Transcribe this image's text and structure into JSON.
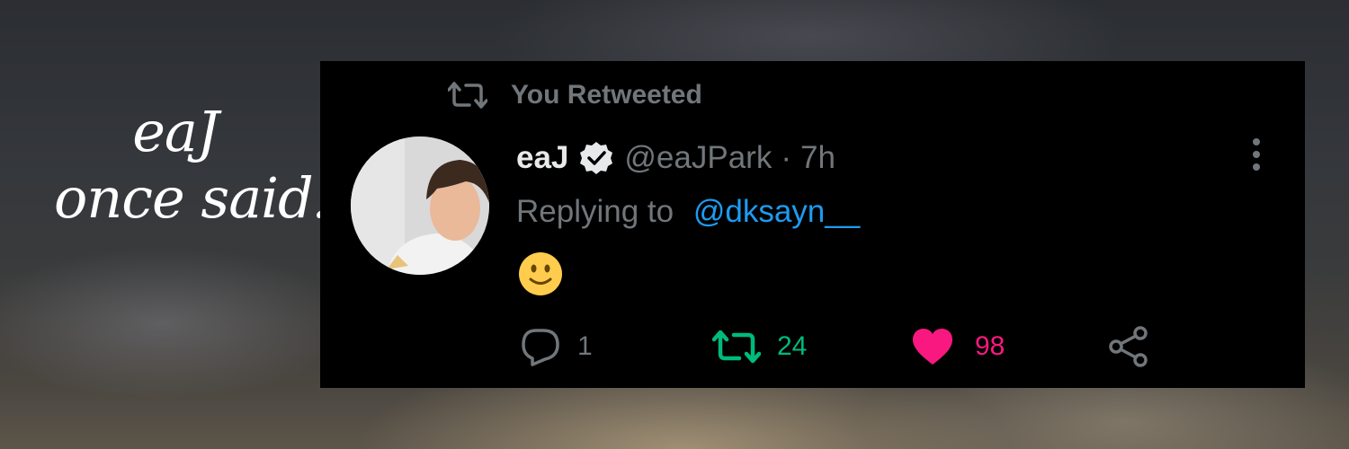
{
  "caption": {
    "line1": "eaJ",
    "line2": "once said:"
  },
  "tweet": {
    "retweet_label": "You Retweeted",
    "author": {
      "display_name": "eaJ",
      "handle": "@eaJPark",
      "separator": "·",
      "time": "7h"
    },
    "reply": {
      "prefix": "Replying to",
      "mention": "@dksayn__"
    },
    "body_emoji": "slightly-smiling-face",
    "actions": {
      "replies": "1",
      "retweets": "24",
      "likes": "98"
    }
  },
  "colors": {
    "accent_blue": "#1d9bf0",
    "retweet_green": "#00ba7c",
    "like_pink": "#f91880",
    "muted": "#71767b"
  }
}
